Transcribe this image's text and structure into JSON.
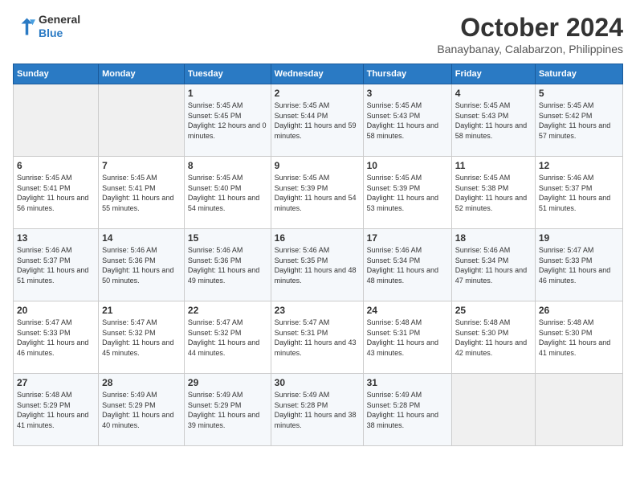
{
  "logo": {
    "line1": "General",
    "line2": "Blue"
  },
  "title": "October 2024",
  "location": "Banaybanay, Calabarzon, Philippines",
  "weekdays": [
    "Sunday",
    "Monday",
    "Tuesday",
    "Wednesday",
    "Thursday",
    "Friday",
    "Saturday"
  ],
  "weeks": [
    [
      {
        "day": "",
        "sunrise": "",
        "sunset": "",
        "daylight": ""
      },
      {
        "day": "",
        "sunrise": "",
        "sunset": "",
        "daylight": ""
      },
      {
        "day": "1",
        "sunrise": "Sunrise: 5:45 AM",
        "sunset": "Sunset: 5:45 PM",
        "daylight": "Daylight: 12 hours and 0 minutes."
      },
      {
        "day": "2",
        "sunrise": "Sunrise: 5:45 AM",
        "sunset": "Sunset: 5:44 PM",
        "daylight": "Daylight: 11 hours and 59 minutes."
      },
      {
        "day": "3",
        "sunrise": "Sunrise: 5:45 AM",
        "sunset": "Sunset: 5:43 PM",
        "daylight": "Daylight: 11 hours and 58 minutes."
      },
      {
        "day": "4",
        "sunrise": "Sunrise: 5:45 AM",
        "sunset": "Sunset: 5:43 PM",
        "daylight": "Daylight: 11 hours and 58 minutes."
      },
      {
        "day": "5",
        "sunrise": "Sunrise: 5:45 AM",
        "sunset": "Sunset: 5:42 PM",
        "daylight": "Daylight: 11 hours and 57 minutes."
      }
    ],
    [
      {
        "day": "6",
        "sunrise": "Sunrise: 5:45 AM",
        "sunset": "Sunset: 5:41 PM",
        "daylight": "Daylight: 11 hours and 56 minutes."
      },
      {
        "day": "7",
        "sunrise": "Sunrise: 5:45 AM",
        "sunset": "Sunset: 5:41 PM",
        "daylight": "Daylight: 11 hours and 55 minutes."
      },
      {
        "day": "8",
        "sunrise": "Sunrise: 5:45 AM",
        "sunset": "Sunset: 5:40 PM",
        "daylight": "Daylight: 11 hours and 54 minutes."
      },
      {
        "day": "9",
        "sunrise": "Sunrise: 5:45 AM",
        "sunset": "Sunset: 5:39 PM",
        "daylight": "Daylight: 11 hours and 54 minutes."
      },
      {
        "day": "10",
        "sunrise": "Sunrise: 5:45 AM",
        "sunset": "Sunset: 5:39 PM",
        "daylight": "Daylight: 11 hours and 53 minutes."
      },
      {
        "day": "11",
        "sunrise": "Sunrise: 5:45 AM",
        "sunset": "Sunset: 5:38 PM",
        "daylight": "Daylight: 11 hours and 52 minutes."
      },
      {
        "day": "12",
        "sunrise": "Sunrise: 5:46 AM",
        "sunset": "Sunset: 5:37 PM",
        "daylight": "Daylight: 11 hours and 51 minutes."
      }
    ],
    [
      {
        "day": "13",
        "sunrise": "Sunrise: 5:46 AM",
        "sunset": "Sunset: 5:37 PM",
        "daylight": "Daylight: 11 hours and 51 minutes."
      },
      {
        "day": "14",
        "sunrise": "Sunrise: 5:46 AM",
        "sunset": "Sunset: 5:36 PM",
        "daylight": "Daylight: 11 hours and 50 minutes."
      },
      {
        "day": "15",
        "sunrise": "Sunrise: 5:46 AM",
        "sunset": "Sunset: 5:36 PM",
        "daylight": "Daylight: 11 hours and 49 minutes."
      },
      {
        "day": "16",
        "sunrise": "Sunrise: 5:46 AM",
        "sunset": "Sunset: 5:35 PM",
        "daylight": "Daylight: 11 hours and 48 minutes."
      },
      {
        "day": "17",
        "sunrise": "Sunrise: 5:46 AM",
        "sunset": "Sunset: 5:34 PM",
        "daylight": "Daylight: 11 hours and 48 minutes."
      },
      {
        "day": "18",
        "sunrise": "Sunrise: 5:46 AM",
        "sunset": "Sunset: 5:34 PM",
        "daylight": "Daylight: 11 hours and 47 minutes."
      },
      {
        "day": "19",
        "sunrise": "Sunrise: 5:47 AM",
        "sunset": "Sunset: 5:33 PM",
        "daylight": "Daylight: 11 hours and 46 minutes."
      }
    ],
    [
      {
        "day": "20",
        "sunrise": "Sunrise: 5:47 AM",
        "sunset": "Sunset: 5:33 PM",
        "daylight": "Daylight: 11 hours and 46 minutes."
      },
      {
        "day": "21",
        "sunrise": "Sunrise: 5:47 AM",
        "sunset": "Sunset: 5:32 PM",
        "daylight": "Daylight: 11 hours and 45 minutes."
      },
      {
        "day": "22",
        "sunrise": "Sunrise: 5:47 AM",
        "sunset": "Sunset: 5:32 PM",
        "daylight": "Daylight: 11 hours and 44 minutes."
      },
      {
        "day": "23",
        "sunrise": "Sunrise: 5:47 AM",
        "sunset": "Sunset: 5:31 PM",
        "daylight": "Daylight: 11 hours and 43 minutes."
      },
      {
        "day": "24",
        "sunrise": "Sunrise: 5:48 AM",
        "sunset": "Sunset: 5:31 PM",
        "daylight": "Daylight: 11 hours and 43 minutes."
      },
      {
        "day": "25",
        "sunrise": "Sunrise: 5:48 AM",
        "sunset": "Sunset: 5:30 PM",
        "daylight": "Daylight: 11 hours and 42 minutes."
      },
      {
        "day": "26",
        "sunrise": "Sunrise: 5:48 AM",
        "sunset": "Sunset: 5:30 PM",
        "daylight": "Daylight: 11 hours and 41 minutes."
      }
    ],
    [
      {
        "day": "27",
        "sunrise": "Sunrise: 5:48 AM",
        "sunset": "Sunset: 5:29 PM",
        "daylight": "Daylight: 11 hours and 41 minutes."
      },
      {
        "day": "28",
        "sunrise": "Sunrise: 5:49 AM",
        "sunset": "Sunset: 5:29 PM",
        "daylight": "Daylight: 11 hours and 40 minutes."
      },
      {
        "day": "29",
        "sunrise": "Sunrise: 5:49 AM",
        "sunset": "Sunset: 5:29 PM",
        "daylight": "Daylight: 11 hours and 39 minutes."
      },
      {
        "day": "30",
        "sunrise": "Sunrise: 5:49 AM",
        "sunset": "Sunset: 5:28 PM",
        "daylight": "Daylight: 11 hours and 38 minutes."
      },
      {
        "day": "31",
        "sunrise": "Sunrise: 5:49 AM",
        "sunset": "Sunset: 5:28 PM",
        "daylight": "Daylight: 11 hours and 38 minutes."
      },
      {
        "day": "",
        "sunrise": "",
        "sunset": "",
        "daylight": ""
      },
      {
        "day": "",
        "sunrise": "",
        "sunset": "",
        "daylight": ""
      }
    ]
  ]
}
